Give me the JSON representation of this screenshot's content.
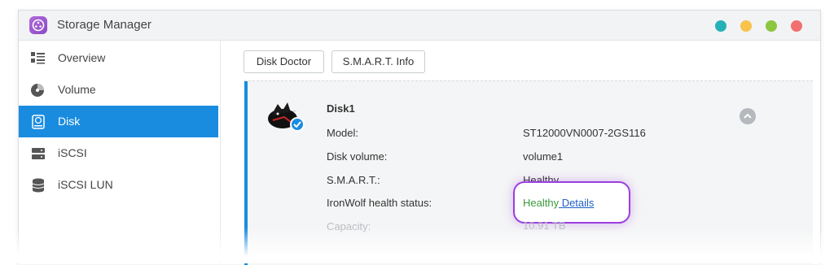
{
  "window": {
    "title": "Storage Manager",
    "app_icon": "storage-manager-icon"
  },
  "window_controls": [
    {
      "name": "info",
      "color": "#26b1b7"
    },
    {
      "name": "minimize",
      "color": "#f8c24b"
    },
    {
      "name": "maximize",
      "color": "#8cc63f"
    },
    {
      "name": "close",
      "color": "#f26f6f"
    }
  ],
  "sidebar": {
    "items": [
      {
        "label": "Overview",
        "icon": "overview-icon"
      },
      {
        "label": "Volume",
        "icon": "volume-icon"
      },
      {
        "label": "Disk",
        "icon": "disk-icon",
        "active": true
      },
      {
        "label": "iSCSI",
        "icon": "iscsi-icon"
      },
      {
        "label": "iSCSI LUN",
        "icon": "iscsi-lun-icon"
      }
    ]
  },
  "toolbar": {
    "disk_doctor": "Disk Doctor",
    "smart_info": "S.M.A.R.T. Info"
  },
  "disk": {
    "name": "Disk1",
    "icon": "seagate-ironwolf-disk-icon",
    "rows": [
      {
        "label": "Model:",
        "value": "ST12000VN0007-2GS116"
      },
      {
        "label": "Disk volume:",
        "value": "volume1"
      },
      {
        "label": "S.M.A.R.T.:",
        "value": "Healthy"
      },
      {
        "label": "IronWolf health status:",
        "value": "Healthy",
        "link": " Details"
      },
      {
        "label": "Capacity:",
        "value": "10.91 TB"
      }
    ]
  }
}
